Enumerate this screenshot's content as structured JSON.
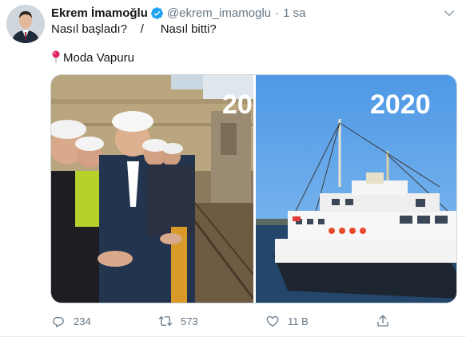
{
  "tweet": {
    "author_name": "Ekrem İmamoğlu",
    "handle": "@ekrem_imamoglu",
    "separator": "·",
    "time": "1 sa",
    "text_line1": "Nasıl başladı?    /     Nasıl bitti?",
    "location_text": "Moda Vapuru",
    "image_right_year": "2020",
    "image_left_year_fragment": "20",
    "reply_count": "234",
    "retweet_count": "573",
    "like_count": "11 B"
  },
  "icons": {
    "verified": "verified-badge-icon",
    "caret": "chevron-down-icon",
    "pin": "round-pushpin-icon",
    "reply": "reply-icon",
    "retweet": "retweet-icon",
    "like": "heart-icon",
    "share": "share-icon"
  },
  "colors": {
    "accent": "#1da1f2",
    "text_primary": "#14171a",
    "text_secondary": "#657786",
    "sky": "#5ea3e8",
    "sea": "#23466a"
  }
}
